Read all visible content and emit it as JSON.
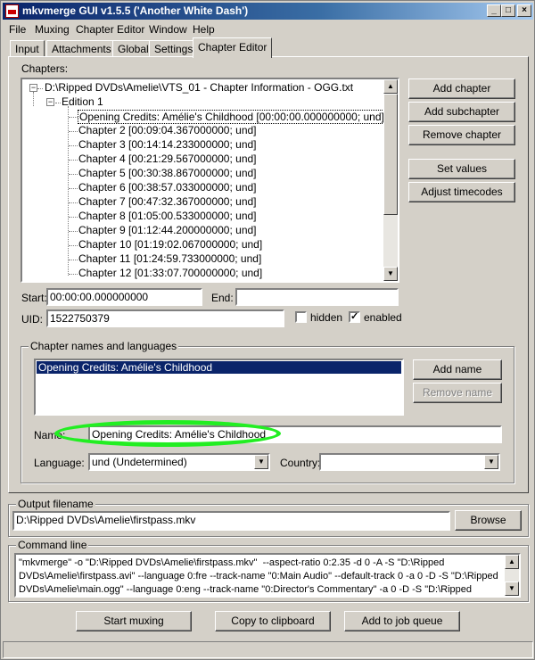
{
  "window": {
    "title": "mkvmerge GUI v1.5.5 ('Another White Dash')",
    "minimize": "_",
    "maximize": "□",
    "close": "×"
  },
  "menu": [
    "File",
    "Muxing",
    "Chapter Editor",
    "Window",
    "Help"
  ],
  "tabs": [
    "Input",
    "Attachments",
    "Global",
    "Settings",
    "Chapter Editor"
  ],
  "chapters": {
    "label": "Chapters:",
    "file": "D:\\Ripped DVDs\\Amelie\\VTS_01 - Chapter Information - OGG.txt",
    "edition": "Edition 1",
    "items": [
      "Opening Credits: Amélie's Childhood [00:00:00.000000000; und]",
      "Chapter 2 [00:09:04.367000000; und]",
      "Chapter 3 [00:14:14.233000000; und]",
      "Chapter 4 [00:21:29.567000000; und]",
      "Chapter 5 [00:30:38.867000000; und]",
      "Chapter 6 [00:38:57.033000000; und]",
      "Chapter 7 [00:47:32.367000000; und]",
      "Chapter 8 [01:05:00.533000000; und]",
      "Chapter 9 [01:12:44.200000000; und]",
      "Chapter 10 [01:19:02.067000000; und]",
      "Chapter 11 [01:24:59.733000000; und]",
      "Chapter 12 [01:33:07.700000000; und]"
    ],
    "buttons": {
      "add_chapter": "Add chapter",
      "add_subchapter": "Add subchapter",
      "remove_chapter": "Remove chapter",
      "set_values": "Set values",
      "adjust_timecodes": "Adjust timecodes"
    }
  },
  "fields": {
    "start_label": "Start:",
    "start_value": "00:00:00.000000000",
    "end_label": "End:",
    "end_value": "",
    "uid_label": "UID:",
    "uid_value": "1522750379",
    "hidden_label": "hidden",
    "hidden_checked": false,
    "enabled_label": "enabled",
    "enabled_checked": true
  },
  "names_group": {
    "title": "Chapter names and languages",
    "list": [
      "Opening Credits: Amélie's Childhood"
    ],
    "add_name": "Add name",
    "remove_name": "Remove name",
    "name_label": "Name:",
    "name_value": "Opening Credits: Amélie's Childhood",
    "language_label": "Language:",
    "language_value": "und (Undetermined)",
    "country_label": "Country:",
    "country_value": ""
  },
  "output": {
    "title": "Output filename",
    "value": "D:\\Ripped DVDs\\Amelie\\firstpass.mkv",
    "browse": "Browse"
  },
  "command": {
    "title": "Command line",
    "lines": [
      "\"mkvmerge\" -o \"D:\\Ripped DVDs\\Amelie\\firstpass.mkv\"  --aspect-ratio 0:2.35 -d 0 -A -S \"D:\\Ripped",
      "DVDs\\Amelie\\firstpass.avi\" --language 0:fre --track-name \"0:Main Audio\" --default-track 0 -a 0 -D -S \"D:\\Ripped",
      "DVDs\\Amelie\\main.ogg\" --language 0:eng --track-name \"0:Director's Commentary\" -a 0 -D -S \"D:\\Ripped"
    ]
  },
  "actions": {
    "start_muxing": "Start muxing",
    "copy_clipboard": "Copy to clipboard",
    "add_job": "Add to job queue"
  },
  "icons": {
    "scroll_up": "▲",
    "scroll_down": "▼",
    "combo_arrow": "▼",
    "tree_collapse": "−",
    "check": "✓"
  },
  "colors": {
    "selection": "#0a246a",
    "highlight_ellipse": "#22ee22"
  }
}
